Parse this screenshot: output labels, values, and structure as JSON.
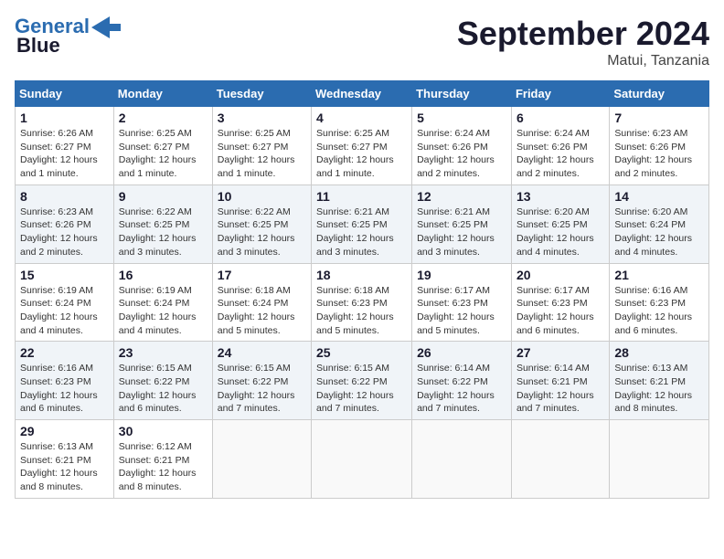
{
  "header": {
    "logo_line1": "General",
    "logo_line2": "Blue",
    "month": "September 2024",
    "location": "Matui, Tanzania"
  },
  "weekdays": [
    "Sunday",
    "Monday",
    "Tuesday",
    "Wednesday",
    "Thursday",
    "Friday",
    "Saturday"
  ],
  "weeks": [
    [
      {
        "day": 1,
        "info": "Sunrise: 6:26 AM\nSunset: 6:27 PM\nDaylight: 12 hours\nand 1 minute."
      },
      {
        "day": 2,
        "info": "Sunrise: 6:25 AM\nSunset: 6:27 PM\nDaylight: 12 hours\nand 1 minute."
      },
      {
        "day": 3,
        "info": "Sunrise: 6:25 AM\nSunset: 6:27 PM\nDaylight: 12 hours\nand 1 minute."
      },
      {
        "day": 4,
        "info": "Sunrise: 6:25 AM\nSunset: 6:27 PM\nDaylight: 12 hours\nand 1 minute."
      },
      {
        "day": 5,
        "info": "Sunrise: 6:24 AM\nSunset: 6:26 PM\nDaylight: 12 hours\nand 2 minutes."
      },
      {
        "day": 6,
        "info": "Sunrise: 6:24 AM\nSunset: 6:26 PM\nDaylight: 12 hours\nand 2 minutes."
      },
      {
        "day": 7,
        "info": "Sunrise: 6:23 AM\nSunset: 6:26 PM\nDaylight: 12 hours\nand 2 minutes."
      }
    ],
    [
      {
        "day": 8,
        "info": "Sunrise: 6:23 AM\nSunset: 6:26 PM\nDaylight: 12 hours\nand 2 minutes."
      },
      {
        "day": 9,
        "info": "Sunrise: 6:22 AM\nSunset: 6:25 PM\nDaylight: 12 hours\nand 3 minutes."
      },
      {
        "day": 10,
        "info": "Sunrise: 6:22 AM\nSunset: 6:25 PM\nDaylight: 12 hours\nand 3 minutes."
      },
      {
        "day": 11,
        "info": "Sunrise: 6:21 AM\nSunset: 6:25 PM\nDaylight: 12 hours\nand 3 minutes."
      },
      {
        "day": 12,
        "info": "Sunrise: 6:21 AM\nSunset: 6:25 PM\nDaylight: 12 hours\nand 3 minutes."
      },
      {
        "day": 13,
        "info": "Sunrise: 6:20 AM\nSunset: 6:25 PM\nDaylight: 12 hours\nand 4 minutes."
      },
      {
        "day": 14,
        "info": "Sunrise: 6:20 AM\nSunset: 6:24 PM\nDaylight: 12 hours\nand 4 minutes."
      }
    ],
    [
      {
        "day": 15,
        "info": "Sunrise: 6:19 AM\nSunset: 6:24 PM\nDaylight: 12 hours\nand 4 minutes."
      },
      {
        "day": 16,
        "info": "Sunrise: 6:19 AM\nSunset: 6:24 PM\nDaylight: 12 hours\nand 4 minutes."
      },
      {
        "day": 17,
        "info": "Sunrise: 6:18 AM\nSunset: 6:24 PM\nDaylight: 12 hours\nand 5 minutes."
      },
      {
        "day": 18,
        "info": "Sunrise: 6:18 AM\nSunset: 6:23 PM\nDaylight: 12 hours\nand 5 minutes."
      },
      {
        "day": 19,
        "info": "Sunrise: 6:17 AM\nSunset: 6:23 PM\nDaylight: 12 hours\nand 5 minutes."
      },
      {
        "day": 20,
        "info": "Sunrise: 6:17 AM\nSunset: 6:23 PM\nDaylight: 12 hours\nand 6 minutes."
      },
      {
        "day": 21,
        "info": "Sunrise: 6:16 AM\nSunset: 6:23 PM\nDaylight: 12 hours\nand 6 minutes."
      }
    ],
    [
      {
        "day": 22,
        "info": "Sunrise: 6:16 AM\nSunset: 6:23 PM\nDaylight: 12 hours\nand 6 minutes."
      },
      {
        "day": 23,
        "info": "Sunrise: 6:15 AM\nSunset: 6:22 PM\nDaylight: 12 hours\nand 6 minutes."
      },
      {
        "day": 24,
        "info": "Sunrise: 6:15 AM\nSunset: 6:22 PM\nDaylight: 12 hours\nand 7 minutes."
      },
      {
        "day": 25,
        "info": "Sunrise: 6:15 AM\nSunset: 6:22 PM\nDaylight: 12 hours\nand 7 minutes."
      },
      {
        "day": 26,
        "info": "Sunrise: 6:14 AM\nSunset: 6:22 PM\nDaylight: 12 hours\nand 7 minutes."
      },
      {
        "day": 27,
        "info": "Sunrise: 6:14 AM\nSunset: 6:21 PM\nDaylight: 12 hours\nand 7 minutes."
      },
      {
        "day": 28,
        "info": "Sunrise: 6:13 AM\nSunset: 6:21 PM\nDaylight: 12 hours\nand 8 minutes."
      }
    ],
    [
      {
        "day": 29,
        "info": "Sunrise: 6:13 AM\nSunset: 6:21 PM\nDaylight: 12 hours\nand 8 minutes."
      },
      {
        "day": 30,
        "info": "Sunrise: 6:12 AM\nSunset: 6:21 PM\nDaylight: 12 hours\nand 8 minutes."
      },
      null,
      null,
      null,
      null,
      null
    ]
  ]
}
